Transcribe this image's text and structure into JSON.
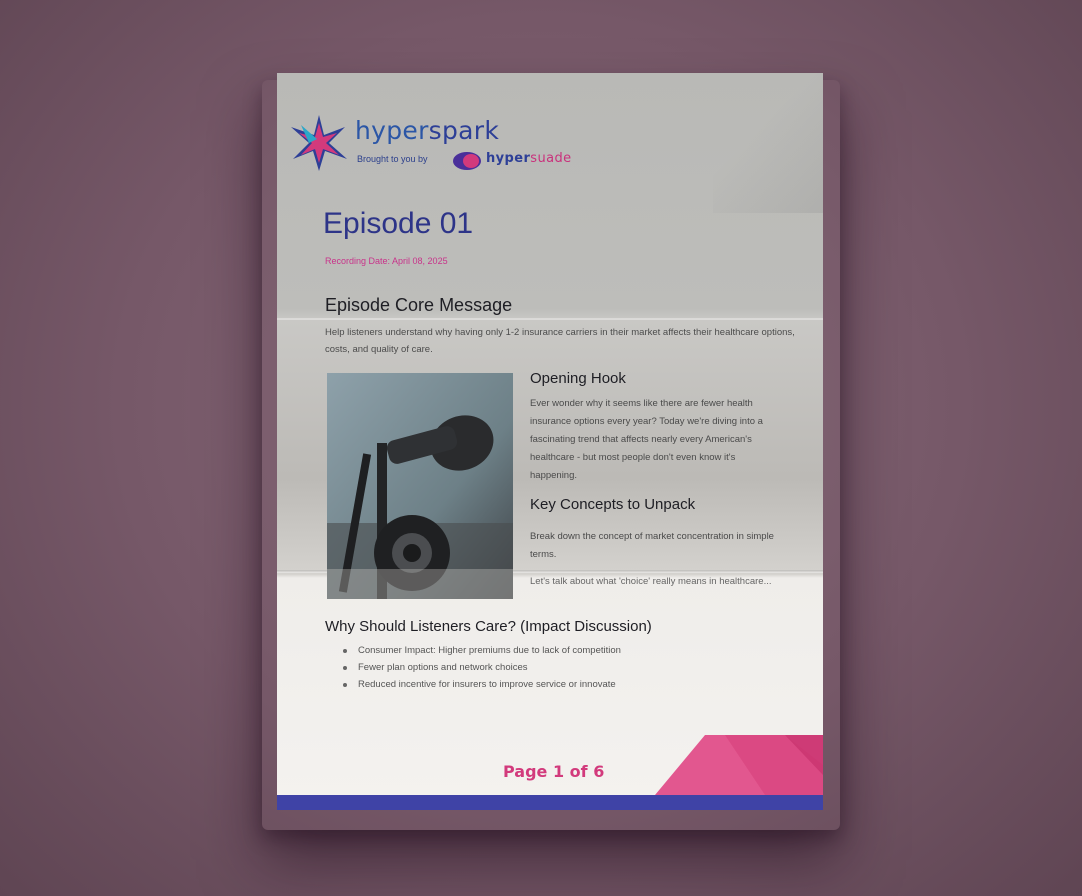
{
  "brand": {
    "name_part1": "hyper",
    "name_part2": "spark",
    "byline": "Brought to you by",
    "sponsor_part1": "hyper",
    "sponsor_part2": "suade"
  },
  "episode": {
    "title": "Episode 01",
    "recording_date": "Recording Date: April 08, 2025"
  },
  "core_message": {
    "heading": "Episode Core Message",
    "body": "Help listeners understand why having only 1-2 insurance carriers in their market affects their healthcare options, costs, and quality of care."
  },
  "opening_hook": {
    "heading": "Opening Hook",
    "body": "Ever wonder why it seems like there are fewer health insurance options every year? Today we're diving into a fascinating trend that affects nearly every American's healthcare - but most people don't even know it's happening."
  },
  "key_concepts": {
    "heading": "Key Concepts to Unpack",
    "items": [
      "Break down the concept of market concentration in simple terms.",
      "Let's talk about what 'choice' really means in healthcare..."
    ]
  },
  "why_care": {
    "heading": "Why Should Listeners Care? (Impact Discussion)",
    "bullets": [
      "Consumer Impact: Higher premiums due to lack of competition",
      "Fewer plan options and network choices",
      "Reduced incentive for insurers to improve service or innovate"
    ]
  },
  "footer": {
    "page_label": "Page 1 of 6"
  },
  "colors": {
    "title_navy": "#2d3488",
    "accent_pink": "#d23a7c",
    "footer_bar": "#3f43a6",
    "background": "#7a5d6c"
  },
  "icons": {
    "logo": "star-burst-icon",
    "sponsor_logo": "blob-icon",
    "photo": "microphone-photo"
  }
}
